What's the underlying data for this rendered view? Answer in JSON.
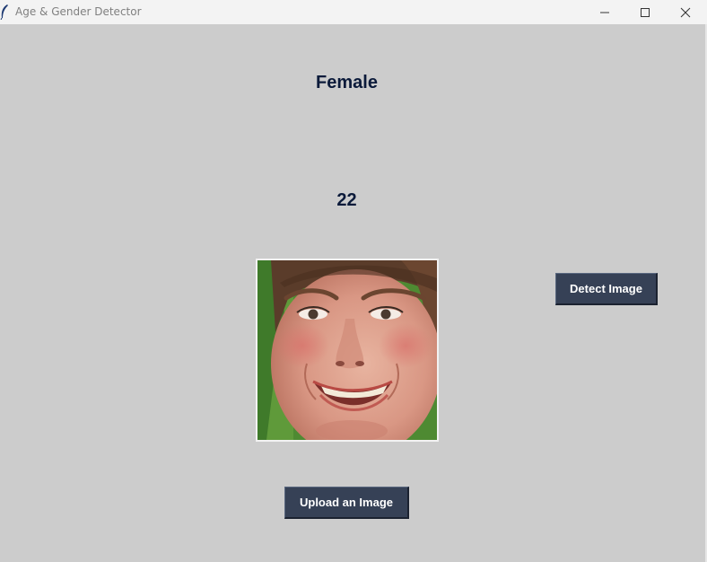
{
  "window": {
    "title": "Age & Gender Detector",
    "icon": "feather-icon",
    "controls": [
      "minimize-icon",
      "maximize-icon",
      "close-icon"
    ]
  },
  "result": {
    "gender": "Female",
    "age": "22"
  },
  "photo": {
    "description_icon": "face-photo"
  },
  "buttons": {
    "detect_label": "Detect Image",
    "upload_label": "Upload an Image"
  },
  "colors": {
    "background": "#cccccc",
    "titlebar": "#f3f3f3",
    "button_bg": "#364156",
    "button_text": "#ffffff",
    "label_text": "#0b1a3a"
  }
}
